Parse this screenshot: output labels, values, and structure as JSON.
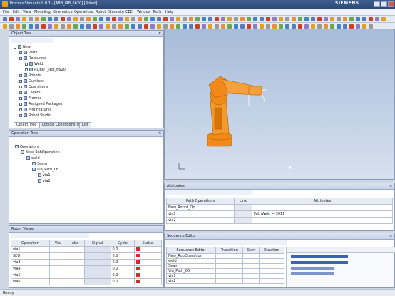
{
  "window": {
    "title": "Process Simulate 9.0.1 - [ABB_IRB_6620] [Robot]",
    "brand": "SIEMENS"
  },
  "menu": [
    "File",
    "Edit",
    "View",
    "Modeling",
    "Kinematics",
    "Operations",
    "Robot",
    "Simulate",
    "CEE",
    "Window",
    "Tools",
    "Help"
  ],
  "object_tree": {
    "title": "Object Tree",
    "tabs": [
      "Object Tree",
      "Logical Collections Tree",
      "List"
    ],
    "items": [
      {
        "label": "New",
        "level": 0
      },
      {
        "label": "Parts",
        "level": 1
      },
      {
        "label": "Resources",
        "level": 1
      },
      {
        "label": "Weld",
        "level": 2
      },
      {
        "label": "ROBOT_IRB_6620",
        "level": 2
      },
      {
        "label": "Robots",
        "level": 1
      },
      {
        "label": "Gunlines",
        "level": 1
      },
      {
        "label": "Operations",
        "level": 1
      },
      {
        "label": "Layers",
        "level": 1
      },
      {
        "label": "Frames",
        "level": 1
      },
      {
        "label": "Assigned Packages",
        "level": 1
      },
      {
        "label": "Mfg Features",
        "level": 1
      },
      {
        "label": "Robot Studio",
        "level": 1
      }
    ]
  },
  "operation_tree": {
    "title": "Operation Tree",
    "items": [
      {
        "label": "Operations",
        "level": 0
      },
      {
        "label": "New_RobOperation",
        "level": 1
      },
      {
        "label": "weld",
        "level": 2
      },
      {
        "label": "Seam",
        "level": 3
      },
      {
        "label": "Via_Path_06",
        "level": 3
      },
      {
        "label": "via1",
        "level": 4
      },
      {
        "label": "via2",
        "level": 4
      }
    ]
  },
  "robot_panel": {
    "title": "Robot Viewer",
    "columns": [
      "Operation",
      "Via",
      "Attr",
      "Signal",
      "Cycle",
      "Status"
    ],
    "rows": [
      {
        "name": "via1",
        "c1": "",
        "c2": "",
        "c3": "0.0",
        "status": "red"
      },
      {
        "name": "SEQ",
        "c1": "",
        "c2": "",
        "c3": "0.0",
        "status": "red"
      },
      {
        "name": "via3",
        "c1": "",
        "c2": "",
        "c3": "0.0",
        "status": "red"
      },
      {
        "name": "via4",
        "c1": "",
        "c2": "",
        "c3": "0.0",
        "status": "red"
      },
      {
        "name": "via5",
        "c1": "",
        "c2": "",
        "c3": "0.0",
        "status": "red"
      },
      {
        "name": "via6",
        "c1": "",
        "c2": "",
        "c3": "0.0",
        "status": "red"
      }
    ]
  },
  "attribute_panel": {
    "title": "Attributes",
    "columns": [
      "Path Operations",
      "Link",
      "Attributes"
    ],
    "rows": [
      {
        "name": "New_Robot_Op",
        "link": "",
        "attr": ""
      },
      {
        "name": "via1",
        "link": "",
        "attr": "PathWeld = 3011"
      },
      {
        "name": "via2",
        "link": "",
        "attr": ""
      }
    ]
  },
  "sequence_editor": {
    "title": "Sequence Editor",
    "columns": [
      "Sequence Editor",
      "Transition",
      "Start",
      "Duration"
    ],
    "rows": [
      {
        "name": "New_RobOperation"
      },
      {
        "name": "weld"
      },
      {
        "name": "Seam"
      },
      {
        "name": "Via_Path_06"
      },
      {
        "name": "via1"
      },
      {
        "name": "via2"
      }
    ]
  },
  "status": {
    "text": "Ready"
  },
  "colors": {
    "robot": "#f28a1a",
    "accent": "#3e63b0"
  }
}
